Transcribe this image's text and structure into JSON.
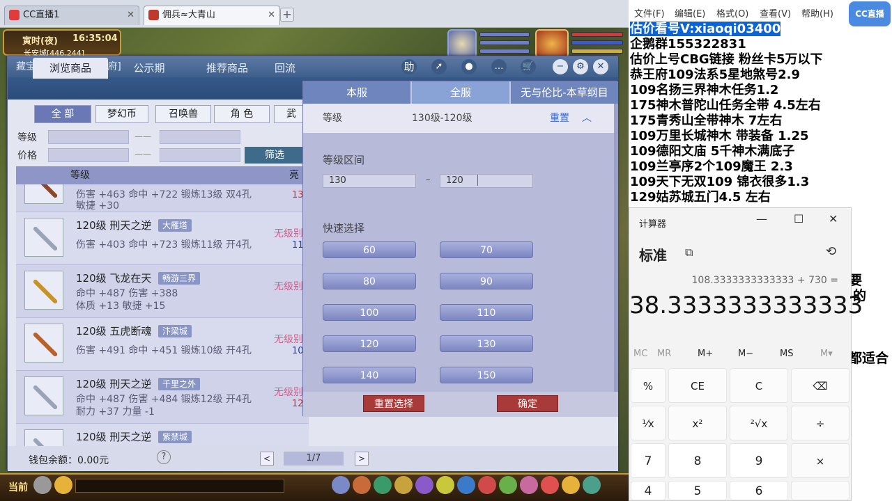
{
  "browser": {
    "tabs": [
      {
        "label": "CC直播1",
        "active": false
      },
      {
        "label": "佣兵≈大青山",
        "active": true
      }
    ],
    "new_tab": "+"
  },
  "game": {
    "time_label": "寅时(夜)",
    "clock": "16:35:04",
    "location": "长安城[446,244]",
    "chat_channel": "当前"
  },
  "window": {
    "title": "藏宝阁-北京2区[顺天府]",
    "title_icons": [
      "助",
      "share-icon",
      "record-icon",
      "chat-icon",
      "cart-icon"
    ],
    "nav_tabs": [
      "浏览商品",
      "公示期",
      "推荐商品",
      "回流"
    ],
    "categories": [
      "全 部",
      "梦幻币",
      "召唤兽",
      "角 色",
      "武"
    ],
    "filters": {
      "level_label": "等级",
      "price_label": "价格",
      "dash": "——",
      "filter_button": "筛选"
    },
    "table_header": {
      "col1": "等级",
      "col2": "亮"
    },
    "rows": [
      {
        "name": "",
        "server": "",
        "line1": "伤害 +463 命中 +722 锻炼13级 双4孔",
        "line2": "敏捷 +30",
        "status": "",
        "price": "13"
      },
      {
        "name": "120级 刑天之逆",
        "server": "大雁塔",
        "line1": "伤害 +403 命中 +723 锻炼11级 开4孔",
        "line2": "",
        "status": "无级别",
        "price": "11"
      },
      {
        "name": "120级 飞龙在天",
        "server": "畅游三界",
        "line1": "命中 +487 伤害 +388",
        "line2": "体质 +13 敏捷 +15",
        "status": "无级别",
        "price": ""
      },
      {
        "name": "120级 五虎断魂",
        "server": "汴梁城",
        "line1": "伤害 +491 命中 +451 锻炼10级 开4孔",
        "line2": "",
        "status": "无级别",
        "price": "10"
      },
      {
        "name": "120级 刑天之逆",
        "server": "千里之外",
        "line1": "命中 +487 伤害 +484 锻炼12级 开4孔",
        "line2": "耐力 +37 力量 -1",
        "status": "无级别",
        "price": "12"
      },
      {
        "name": "120级 刑天之逆",
        "server": "紫禁城",
        "line1": "",
        "line2": "",
        "status": "",
        "price": ""
      }
    ],
    "footer": {
      "wallet": "钱包余额：0.00元",
      "help": "?",
      "page": "1/7",
      "prev": "<",
      "next": ">"
    }
  },
  "popup": {
    "tabs": [
      "本服",
      "全服",
      "无与伦比-本草纲目"
    ],
    "active_tab": 1,
    "header_label": "等级",
    "header_value": "130级-120级",
    "reset_link": "重置",
    "range_label": "等级区间",
    "range_from": "130",
    "range_to": "120",
    "range_dash": "–",
    "quick_label": "快速选择",
    "quick_options": [
      "60",
      "70",
      "80",
      "90",
      "100",
      "110",
      "120",
      "130",
      "140",
      "150"
    ],
    "reset_button": "重置选择",
    "confirm_button": "确定"
  },
  "notepad": {
    "menu": [
      "文件(F)",
      "编辑(E)",
      "格式(O)",
      "查看(V)",
      "帮助(H)"
    ],
    "lines": [
      "估价看号V:xiaoqi03400",
      "企鹅群155322831",
      "估价上号CBG链接 粉丝卡5万以下",
      "恭王府109法系5星地煞号2.9",
      "109名扬三界神木任务1.2",
      "175神木普陀山任务全带 4.5左右",
      "175青秀山全带神木  7左右",
      "109万里长城神木 带装备  1.25",
      "109德阳文庙 5千神木满底子",
      "109兰亭序2个109魔王 2.3",
      "109天下无双109  锦衣很多1.3",
      "129姑苏城五门4.5 左右"
    ],
    "behind_texts": [
      "要",
      "的",
      "都适合"
    ],
    "logo": "CC直播"
  },
  "calculator": {
    "title": "计算器",
    "mode": "标准",
    "expression": "108.3333333333333 + 730 =",
    "value": "38.3333333333333",
    "memory": [
      "MC",
      "MR",
      "M+",
      "M−",
      "MS",
      "M▾"
    ],
    "keys": [
      [
        "%",
        "CE",
        "C",
        "⌫"
      ],
      [
        "¹⁄x",
        "x²",
        "²√x",
        "÷"
      ],
      [
        "7",
        "8",
        "9",
        "×"
      ],
      [
        "4",
        "5",
        "6",
        ""
      ]
    ]
  }
}
